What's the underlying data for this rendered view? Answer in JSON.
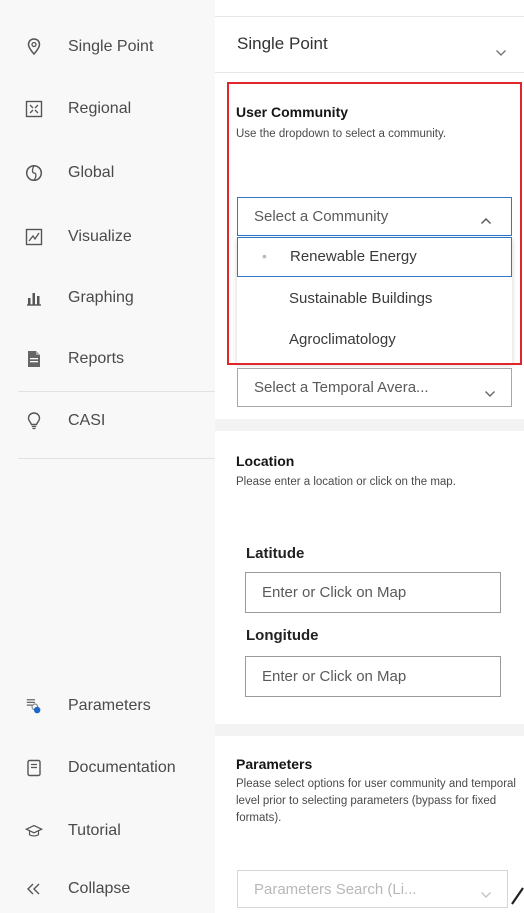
{
  "sidebar": {
    "items": [
      {
        "label": "Single Point",
        "icon": "location-pin-icon"
      },
      {
        "label": "Regional",
        "icon": "region-expand-icon"
      },
      {
        "label": "Global",
        "icon": "globe-icon"
      },
      {
        "label": "Visualize",
        "icon": "chart-image-icon"
      },
      {
        "label": "Graphing",
        "icon": "bar-chart-icon"
      },
      {
        "label": "Reports",
        "icon": "document-icon"
      },
      {
        "label": "CASI",
        "icon": "lightbulb-icon"
      }
    ],
    "bottom_items": [
      {
        "label": "Parameters",
        "icon": "parameters-icon"
      },
      {
        "label": "Documentation",
        "icon": "book-icon"
      },
      {
        "label": "Tutorial",
        "icon": "graduation-cap-icon"
      },
      {
        "label": "Collapse",
        "icon": "double-chevron-left-icon"
      }
    ]
  },
  "main": {
    "mode_select": {
      "value": "Single Point"
    },
    "user_community": {
      "title": "User Community",
      "help": "Use the dropdown to select a community.",
      "select_placeholder": "Select a Community",
      "options": [
        "Renewable Energy",
        "Sustainable Buildings",
        "Agroclimatology"
      ],
      "highlighted_option": "Renewable Energy"
    },
    "temporal": {
      "select_placeholder": "Select a Temporal Avera..."
    },
    "location": {
      "title": "Location",
      "help": "Please enter a location or click on the map.",
      "latitude_label": "Latitude",
      "latitude_placeholder": "Enter or Click on Map",
      "longitude_label": "Longitude",
      "longitude_placeholder": "Enter or Click on Map"
    },
    "parameters": {
      "title": "Parameters",
      "help": "Please select options for user community and temporal level prior to selecting parameters (bypass for fixed formats).",
      "search_placeholder": "Parameters Search (Li..."
    }
  },
  "colors": {
    "accent_blue": "#2f77c7",
    "highlight_red": "#e0262a",
    "sidebar_bg": "#f8f8f8"
  }
}
